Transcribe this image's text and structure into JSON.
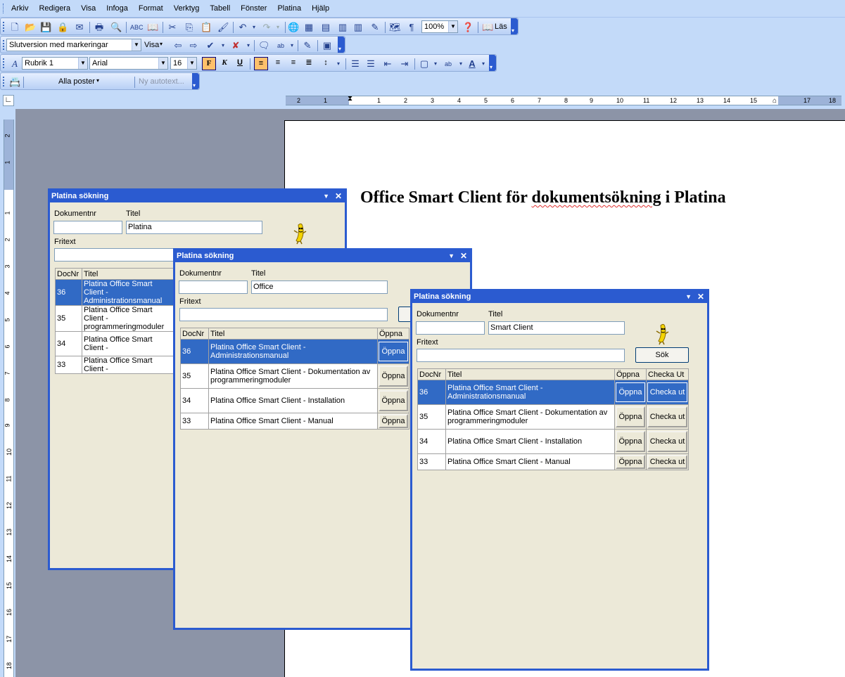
{
  "menu": [
    "Arkiv",
    "Redigera",
    "Visa",
    "Infoga",
    "Format",
    "Verktyg",
    "Tabell",
    "Fönster",
    "Platina",
    "Hjälp"
  ],
  "toolbar_standard": {
    "zoom": "100%",
    "read_label": "Läs"
  },
  "toolbar_review": {
    "display_mode": "Slutversion med markeringar",
    "show_label": "Visa"
  },
  "toolbar_format": {
    "style": "Rubrik 1",
    "font": "Arial",
    "size": "16",
    "bold": "F",
    "italic": "K",
    "underline": "U"
  },
  "toolbar_autotext": {
    "all_entries": "Alla poster",
    "new_autotext": "Ny autotext..."
  },
  "ruler": {
    "h_numbers": [
      "2",
      "1",
      "1",
      "2",
      "3",
      "4",
      "5",
      "6",
      "7",
      "8",
      "9",
      "10",
      "11",
      "12",
      "13",
      "14",
      "15",
      "17",
      "18"
    ],
    "v_numbers": [
      "2",
      "1",
      "1",
      "2",
      "3",
      "4",
      "5",
      "6",
      "7",
      "8",
      "9",
      "10",
      "11",
      "12",
      "13",
      "14",
      "15",
      "16",
      "17",
      "18"
    ]
  },
  "document": {
    "title_pre": "Office Smart Client för ",
    "title_misspelled": "dokumentsökning",
    "title_post": " i Platina"
  },
  "panes": [
    {
      "title": "Platina sökning",
      "docnr_label": "Dokumentnr",
      "title_label": "Titel",
      "fritext_label": "Fritext",
      "docnr_value": "",
      "title_value": "Platina",
      "fritext_value": "",
      "columns": [
        "DocNr",
        "Titel"
      ],
      "rows": [
        {
          "nr": "36",
          "titel": "Platina Office Smart Client - Administrationsmanual",
          "selected": true
        },
        {
          "nr": "35",
          "titel": "Platina Office Smart Client - programmeringmoduler",
          "selected": false
        },
        {
          "nr": "34",
          "titel": "Platina Office Smart Client -",
          "selected": false
        },
        {
          "nr": "33",
          "titel": "Platina Office Smart Client -",
          "selected": false
        }
      ]
    },
    {
      "title": "Platina sökning",
      "docnr_label": "Dokumentnr",
      "title_label": "Titel",
      "fritext_label": "Fritext",
      "docnr_value": "",
      "title_value": "Office",
      "fritext_value": "",
      "columns": [
        "DocNr",
        "Titel",
        "Öppna"
      ],
      "rows": [
        {
          "nr": "36",
          "titel": "Platina Office Smart Client - Administrationsmanual",
          "open": "Öppna",
          "selected": true
        },
        {
          "nr": "35",
          "titel": "Platina Office Smart Client - Dokumentation av programmeringmoduler",
          "open": "Öppna",
          "selected": false
        },
        {
          "nr": "34",
          "titel": "Platina Office Smart Client - Installation",
          "open": "Öppna",
          "selected": false
        },
        {
          "nr": "33",
          "titel": "Platina Office Smart Client - Manual",
          "open": "Öppna",
          "selected": false
        }
      ]
    },
    {
      "title": "Platina sökning",
      "docnr_label": "Dokumentnr",
      "title_label": "Titel",
      "fritext_label": "Fritext",
      "docnr_value": "",
      "title_value": "Smart Client",
      "fritext_value": "",
      "search_button": "Sök",
      "columns": [
        "DocNr",
        "Titel",
        "Öppna",
        "Checka Ut"
      ],
      "rows": [
        {
          "nr": "36",
          "titel": "Platina Office Smart Client - Administrationsmanual",
          "open": "Öppna",
          "checkout": "Checka ut",
          "selected": true
        },
        {
          "nr": "35",
          "titel": "Platina Office Smart Client - Dokumentation av programmeringmoduler",
          "open": "Öppna",
          "checkout": "Checka ut",
          "selected": false
        },
        {
          "nr": "34",
          "titel": "Platina Office Smart Client - Installation",
          "open": "Öppna",
          "checkout": "Checka ut",
          "selected": false
        },
        {
          "nr": "33",
          "titel": "Platina Office Smart Client - Manual",
          "open": "Öppna",
          "checkout": "Checka ut",
          "selected": false
        }
      ]
    }
  ],
  "colors": {
    "pane_blue": "#2b5bd0",
    "selection": "#316ac5",
    "workspace": "#8c94a7",
    "pane_bg": "#ece9d8"
  }
}
